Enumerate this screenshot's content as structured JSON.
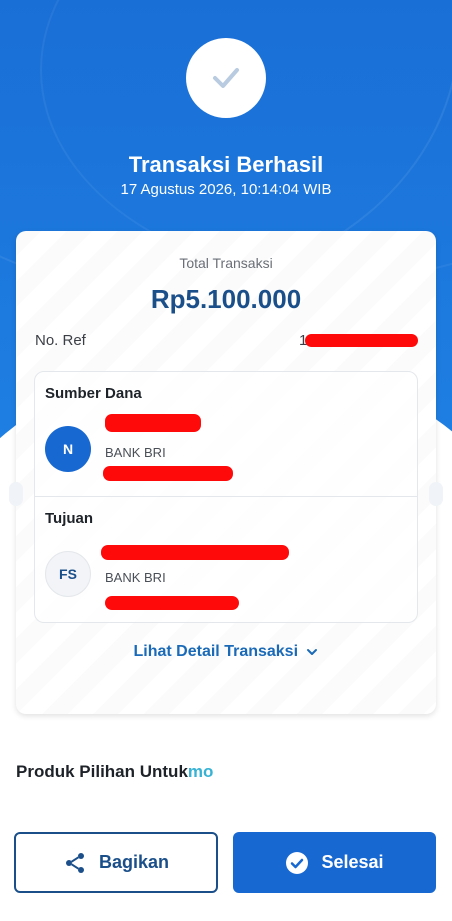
{
  "header": {
    "title": "Transaksi Berhasil",
    "datetime": "17 Agustus 2026, 10:14:04 WIB"
  },
  "card": {
    "total_label": "Total Transaksi",
    "total_amount": "Rp5.100.000",
    "ref_label": "No. Ref",
    "ref_value_visible": "1"
  },
  "source": {
    "title": "Sumber Dana",
    "avatar_initial": "N",
    "bank": "BANK BRI"
  },
  "destination": {
    "title": "Tujuan",
    "avatar_initial": "FS",
    "bank": "BANK BRI"
  },
  "detail_link": "Lihat Detail Transaksi",
  "produk": {
    "label": "Produk Pilihan Untuk",
    "brand": "mo"
  },
  "actions": {
    "share_label": "Bagikan",
    "done_label": "Selesai"
  },
  "colors": {
    "primary": "#1868d1",
    "dark_blue": "#1b4f8a",
    "redaction": "#ff0a0a"
  },
  "icons": {
    "success": "check-icon",
    "share": "share-icon",
    "done": "check-circle-icon",
    "expand": "chevron-down-icon"
  }
}
